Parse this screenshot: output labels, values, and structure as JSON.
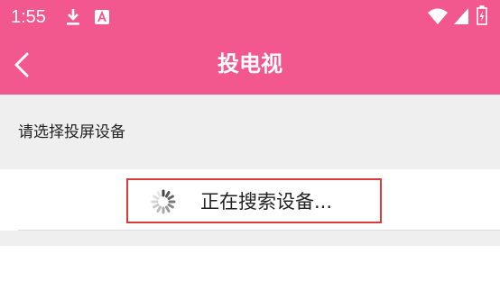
{
  "status_bar": {
    "time": "1:55",
    "icons": [
      "download-icon",
      "a-letter-notification-icon",
      "wifi-icon",
      "signal-icon",
      "battery-charging-icon"
    ]
  },
  "app_bar": {
    "title": "投电视",
    "back_icon": "chevron-left-icon"
  },
  "prompt": {
    "text": "请选择投屏设备"
  },
  "device_list": {
    "status_text": "正在搜索设备...",
    "spinner_icon": "loading-spinner-icon"
  },
  "colors": {
    "brand": "#f2578e",
    "highlight_border": "#d93a3a",
    "section_bg": "#efefef"
  }
}
